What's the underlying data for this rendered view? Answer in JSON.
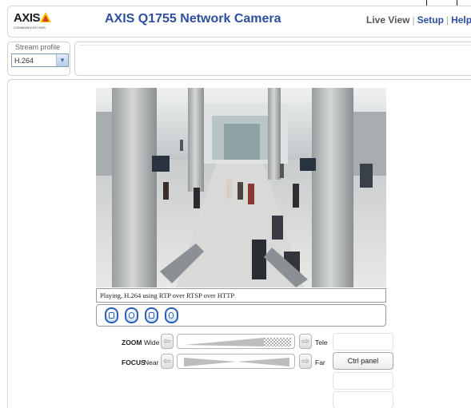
{
  "header": {
    "logo_text": "AXIS",
    "logo_subtext": "COMMUNICATIONS",
    "title": "AXIS Q1755 Network Camera",
    "nav": {
      "live_view": "Live View",
      "setup": "Setup",
      "help": "Help",
      "separator": "|"
    }
  },
  "stream_profile": {
    "label": "Stream profile",
    "selected": "H.264"
  },
  "video": {
    "status_text": "Playing, H.264 using RTP over RTSP over HTTP"
  },
  "controls": {
    "zoom": {
      "label": "ZOOM",
      "left_text": "Wide",
      "right_text": "Tele"
    },
    "focus": {
      "label": "FOCUS",
      "left_text": "Near",
      "right_text": "Far"
    },
    "ctrl_panel_label": "Ctrl panel"
  },
  "icons": {
    "toolbar": [
      "stop-icon",
      "snapshot-icon",
      "view-full-size-icon",
      "record-icon"
    ],
    "arrows": [
      "arrow-left-icon",
      "arrow-right-icon"
    ]
  },
  "colors": {
    "title_blue": "#2d4f9e",
    "button_blue": "#2b5fb3",
    "logo_yellow": "#f5c400"
  }
}
